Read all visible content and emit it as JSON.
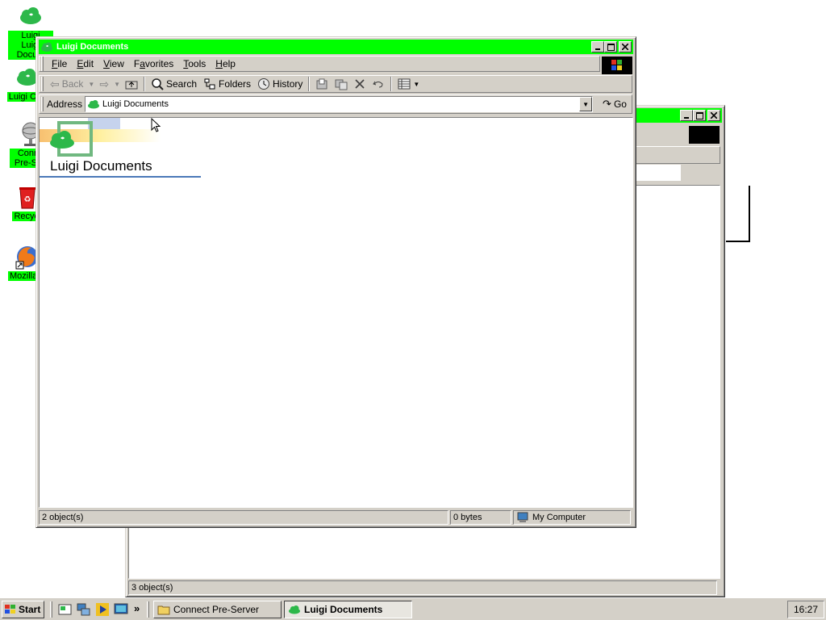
{
  "desktop": {
    "icons": [
      {
        "label": "Luigi Docum",
        "label_line1": "Luigi",
        "icon": "cloud-icon"
      },
      {
        "label": "Luigi Con",
        "icon": "cloud-icon"
      },
      {
        "label_line1": "Conn",
        "label_line2": "Pre-Se",
        "icon": "network-server-icon"
      },
      {
        "label": "Recycl",
        "icon": "recycle-bin-icon"
      },
      {
        "label": "Mozilla F",
        "icon": "firefox-icon"
      }
    ]
  },
  "back_window": {
    "status_text": "3 object(s)"
  },
  "front_window": {
    "title": "Luigi Documents",
    "menu": [
      {
        "pre": "",
        "key": "F",
        "post": "ile"
      },
      {
        "pre": "",
        "key": "E",
        "post": "dit"
      },
      {
        "pre": "",
        "key": "V",
        "post": "iew"
      },
      {
        "pre": "F",
        "key": "a",
        "post": "vorites"
      },
      {
        "pre": "",
        "key": "T",
        "post": "ools"
      },
      {
        "pre": "",
        "key": "H",
        "post": "elp"
      }
    ],
    "toolbar": {
      "back": "Back",
      "search": "Search",
      "folders": "Folders",
      "history": "History"
    },
    "address": {
      "label": "Address",
      "value": "Luigi Documents",
      "go": "Go"
    },
    "content": {
      "folder_title": "Luigi Documents"
    },
    "status": {
      "objects": "2 object(s)",
      "size": "0 bytes",
      "zone": "My Computer"
    }
  },
  "taskbar": {
    "start": "Start",
    "tasks": [
      {
        "label": "Connect Pre-Server",
        "active": false
      },
      {
        "label": "Luigi Documents",
        "active": true
      }
    ],
    "clock": "16:27",
    "overflow": "»"
  },
  "colors": {
    "titlebar": "#00ff00",
    "label_highlight": "#00ff00",
    "chrome": "#d4d0c8",
    "accent_cloud": "#2db84a"
  }
}
